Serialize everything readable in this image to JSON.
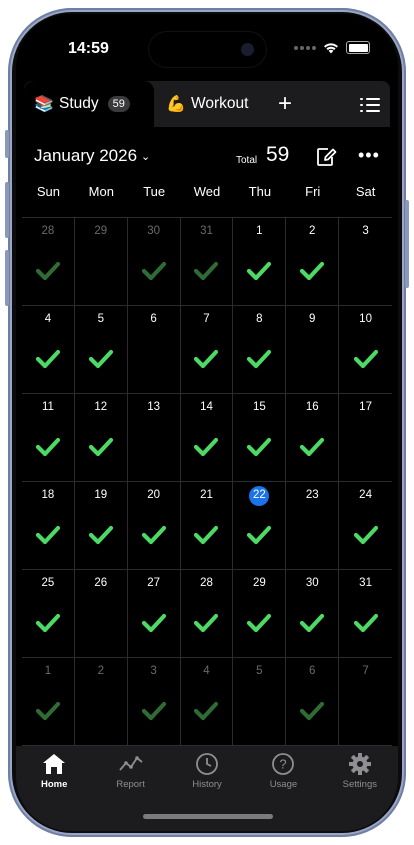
{
  "status_bar": {
    "time": "14:59"
  },
  "tabs": [
    {
      "emoji": "📚",
      "label": "Study",
      "badge": "59",
      "active": true
    },
    {
      "emoji": "💪",
      "label": "Workout",
      "active": false
    }
  ],
  "add_tab_label": "+",
  "header": {
    "month": "January 2026",
    "total_label": "Total",
    "total_value": "59"
  },
  "weekdays": [
    "Sun",
    "Mon",
    "Tue",
    "Wed",
    "Thu",
    "Fri",
    "Sat"
  ],
  "calendar": {
    "days": [
      {
        "n": "28",
        "out": true,
        "checked": true
      },
      {
        "n": "29",
        "out": true,
        "checked": false
      },
      {
        "n": "30",
        "out": true,
        "checked": true
      },
      {
        "n": "31",
        "out": true,
        "checked": true
      },
      {
        "n": "1",
        "checked": true
      },
      {
        "n": "2",
        "checked": true
      },
      {
        "n": "3",
        "checked": false
      },
      {
        "n": "4",
        "checked": true
      },
      {
        "n": "5",
        "checked": true
      },
      {
        "n": "6",
        "checked": false
      },
      {
        "n": "7",
        "checked": true
      },
      {
        "n": "8",
        "checked": true
      },
      {
        "n": "9",
        "checked": false
      },
      {
        "n": "10",
        "checked": true
      },
      {
        "n": "11",
        "checked": true
      },
      {
        "n": "12",
        "checked": true
      },
      {
        "n": "13",
        "checked": false
      },
      {
        "n": "14",
        "checked": true
      },
      {
        "n": "15",
        "checked": true
      },
      {
        "n": "16",
        "checked": true
      },
      {
        "n": "17",
        "checked": false
      },
      {
        "n": "18",
        "checked": true
      },
      {
        "n": "19",
        "checked": true
      },
      {
        "n": "20",
        "checked": true
      },
      {
        "n": "21",
        "checked": true
      },
      {
        "n": "22",
        "checked": true,
        "today": true
      },
      {
        "n": "23",
        "checked": false
      },
      {
        "n": "24",
        "checked": true
      },
      {
        "n": "25",
        "checked": true
      },
      {
        "n": "26",
        "checked": false
      },
      {
        "n": "27",
        "checked": true
      },
      {
        "n": "28",
        "checked": true
      },
      {
        "n": "29",
        "checked": true
      },
      {
        "n": "30",
        "checked": true
      },
      {
        "n": "31",
        "checked": true
      },
      {
        "n": "1",
        "out": true,
        "checked": true
      },
      {
        "n": "2",
        "out": true,
        "checked": false
      },
      {
        "n": "3",
        "out": true,
        "checked": true
      },
      {
        "n": "4",
        "out": true,
        "checked": true
      },
      {
        "n": "5",
        "out": true,
        "checked": false
      },
      {
        "n": "6",
        "out": true,
        "checked": true
      },
      {
        "n": "7",
        "out": true,
        "checked": false
      }
    ]
  },
  "colors": {
    "check": "#4cd964",
    "check_dim": "#2e6b35",
    "today": "#1a73e8"
  },
  "bottom_nav": [
    {
      "label": "Home",
      "icon": "home-icon",
      "active": true
    },
    {
      "label": "Report",
      "icon": "report-icon"
    },
    {
      "label": "History",
      "icon": "history-icon"
    },
    {
      "label": "Usage",
      "icon": "usage-icon"
    },
    {
      "label": "Settings",
      "icon": "settings-icon"
    }
  ]
}
